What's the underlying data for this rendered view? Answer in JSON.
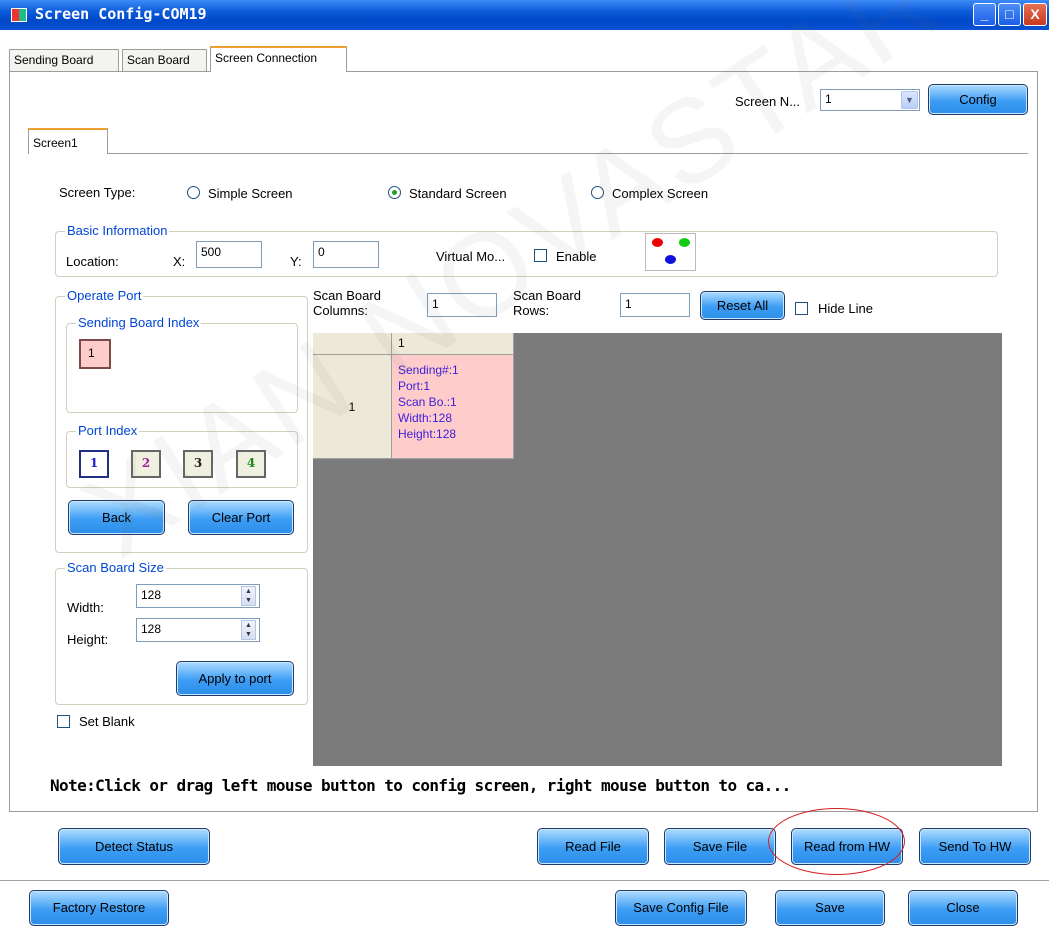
{
  "window": {
    "title": "Screen Config-COM19",
    "controls": [
      "_",
      "□",
      "X"
    ]
  },
  "tabs": [
    {
      "label": "Sending Board",
      "active": false
    },
    {
      "label": "Scan Board",
      "active": false
    },
    {
      "label": "Screen Connection",
      "active": true
    }
  ],
  "header": {
    "screen_n_label": "Screen N...",
    "screen_n_value": "1",
    "config_label": "Config"
  },
  "screen_tab": "Screen1",
  "screen_type": {
    "label": "Screen Type:",
    "options": [
      {
        "label": "Simple Screen",
        "selected": false
      },
      {
        "label": "Standard Screen",
        "selected": true
      },
      {
        "label": "Complex Screen",
        "selected": false
      }
    ]
  },
  "basic_info": {
    "legend": "Basic Information",
    "location_label": "Location:",
    "x_label": "X:",
    "x_value": "500",
    "y_label": "Y:",
    "y_value": "0",
    "virtual_mode_label": "Virtual Mo...",
    "enable_label": "Enable",
    "enable_checked": false
  },
  "operate_port": {
    "legend": "Operate Port",
    "sending_index": {
      "legend": "Sending Board Index",
      "items": [
        "1"
      ]
    },
    "port_index": {
      "legend": "Port Index",
      "items": [
        "1",
        "2",
        "3",
        "4"
      ]
    },
    "back_label": "Back",
    "clear_port_label": "Clear Port"
  },
  "scan_board_size": {
    "legend": "Scan Board Size",
    "width_label": "Width:",
    "width_value": "128",
    "height_label": "Height:",
    "height_value": "128",
    "apply_label": "Apply to port"
  },
  "set_blank_label": "Set Blank",
  "grid_controls": {
    "columns_label": "Scan Board Columns:",
    "columns_value": "1",
    "rows_label": "Scan Board Rows:",
    "rows_value": "1",
    "reset_all_label": "Reset All",
    "hide_line_label": "Hide Line"
  },
  "grid": {
    "column_header": "1",
    "row_header": "1",
    "cell": {
      "sending": "Sending#:1",
      "port": "Port:1",
      "scan_board": "Scan Bo.:1",
      "width": "Width:128",
      "height": "Height:128"
    }
  },
  "note": "Note:Click or drag left mouse button to config screen, right mouse button to ca...",
  "footer": {
    "detect_status": "Detect Status",
    "read_file": "Read File",
    "save_file": "Save File",
    "read_from_hw": "Read from HW",
    "send_to_hw": "Send To HW",
    "factory_restore": "Factory Restore",
    "save_config_file": "Save Config File",
    "save": "Save",
    "close": "Close"
  },
  "watermark": "XIAN NOVASTAR TECH CO., LTD",
  "colors": {
    "title_bar": "#0a5ad9",
    "group_label": "#0046d5",
    "cell_bg": "#ffcccc",
    "cell_text": "#3b1fd8",
    "highlight_ring": "#d42020"
  }
}
